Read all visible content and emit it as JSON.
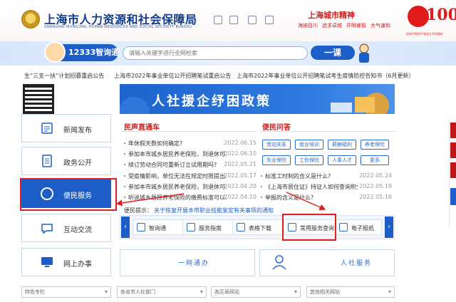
{
  "header": {
    "org_title": "上海市人力资源和社会保障局",
    "org_subtitle": "SHANGHAI MUNICIPAL HUMAN RESOURCES AND SOCIAL SECURITY BUREAU",
    "spirit_title": "上海城市精神",
    "spirit_items": [
      "海纳百川",
      "追求卓越",
      "开明睿智",
      "大气谦和"
    ],
    "anniv_number": "100",
    "anniv_text": "庆祝中国共产党成立100周年"
  },
  "search": {
    "badge": "12333智询通",
    "placeholder": "请输入关键字进行全网检索",
    "button": "一课"
  },
  "notices": [
    "生“三支一扶”计划招募重启公告",
    "上海市2022年事业单位公开招聘笔试重启公告",
    "上海市2022年事业单位公开招聘笔试考生疫情防控告知书（6月更新）"
  ],
  "banner": {
    "title": "人社援企纾困政策"
  },
  "sidebar": {
    "items": [
      {
        "label": "新闻发布"
      },
      {
        "label": "政务公开"
      },
      {
        "label": "便民服务"
      },
      {
        "label": "互动交流"
      },
      {
        "label": "网上办事"
      }
    ]
  },
  "news": {
    "title": "民声直通车",
    "rows": [
      {
        "text": "年休假天数如何确定?",
        "date": "2022.06.15"
      },
      {
        "text": "参加本市城乡居民养老保险，到退休可...",
        "date": "2022.06.10"
      },
      {
        "text": "续订劳动合同可重新订立试用期吗?",
        "date": "2022.05.21"
      },
      {
        "text": "受疫情影响，单位无法在规定时限提出...",
        "date": "2022.05.17"
      },
      {
        "text": "参加本市城乡居民养老保险，到退休可...",
        "date": "2022.04.20"
      },
      {
        "text": "听说城乡居民养老保险的缴费标准可以...",
        "date": "2022.04.10"
      }
    ]
  },
  "qa": {
    "title": "便民问答",
    "tags": [
      "劳动关系",
      "就业培训",
      "薪酬福利",
      "养老保险",
      "失业保险",
      "工伤保险",
      "人事人才",
      "更多"
    ],
    "rows": [
      {
        "text": "标准工时制的含义是什么?",
        "date": "2022.05.24"
      },
      {
        "text": "《上海市居住证》持证人如何查询积分?",
        "date": "2022.05.19"
      },
      {
        "text": "举报的含义是什么?",
        "date": "2022.05.16"
      }
    ]
  },
  "tip": {
    "label": "便民提示：",
    "link": "关于恢复开展本市职业技能鉴定有关事项的通知"
  },
  "services": {
    "prev": "‹",
    "next": "›",
    "items": [
      {
        "label": "智询通"
      },
      {
        "label": "服务指南"
      },
      {
        "label": "表格下载"
      },
      {
        "label": "常用服务查询"
      },
      {
        "label": "电子报纸"
      }
    ]
  },
  "blocks": {
    "left": "一网通办",
    "right": "人社服务"
  },
  "selects": [
    "特色专栏",
    "各省市人社部门",
    "各区局网站",
    "其他相关网站"
  ],
  "colors": {
    "primary": "#1d5dc8",
    "highlight": "#e02020",
    "accent_red": "#c81e1e"
  }
}
